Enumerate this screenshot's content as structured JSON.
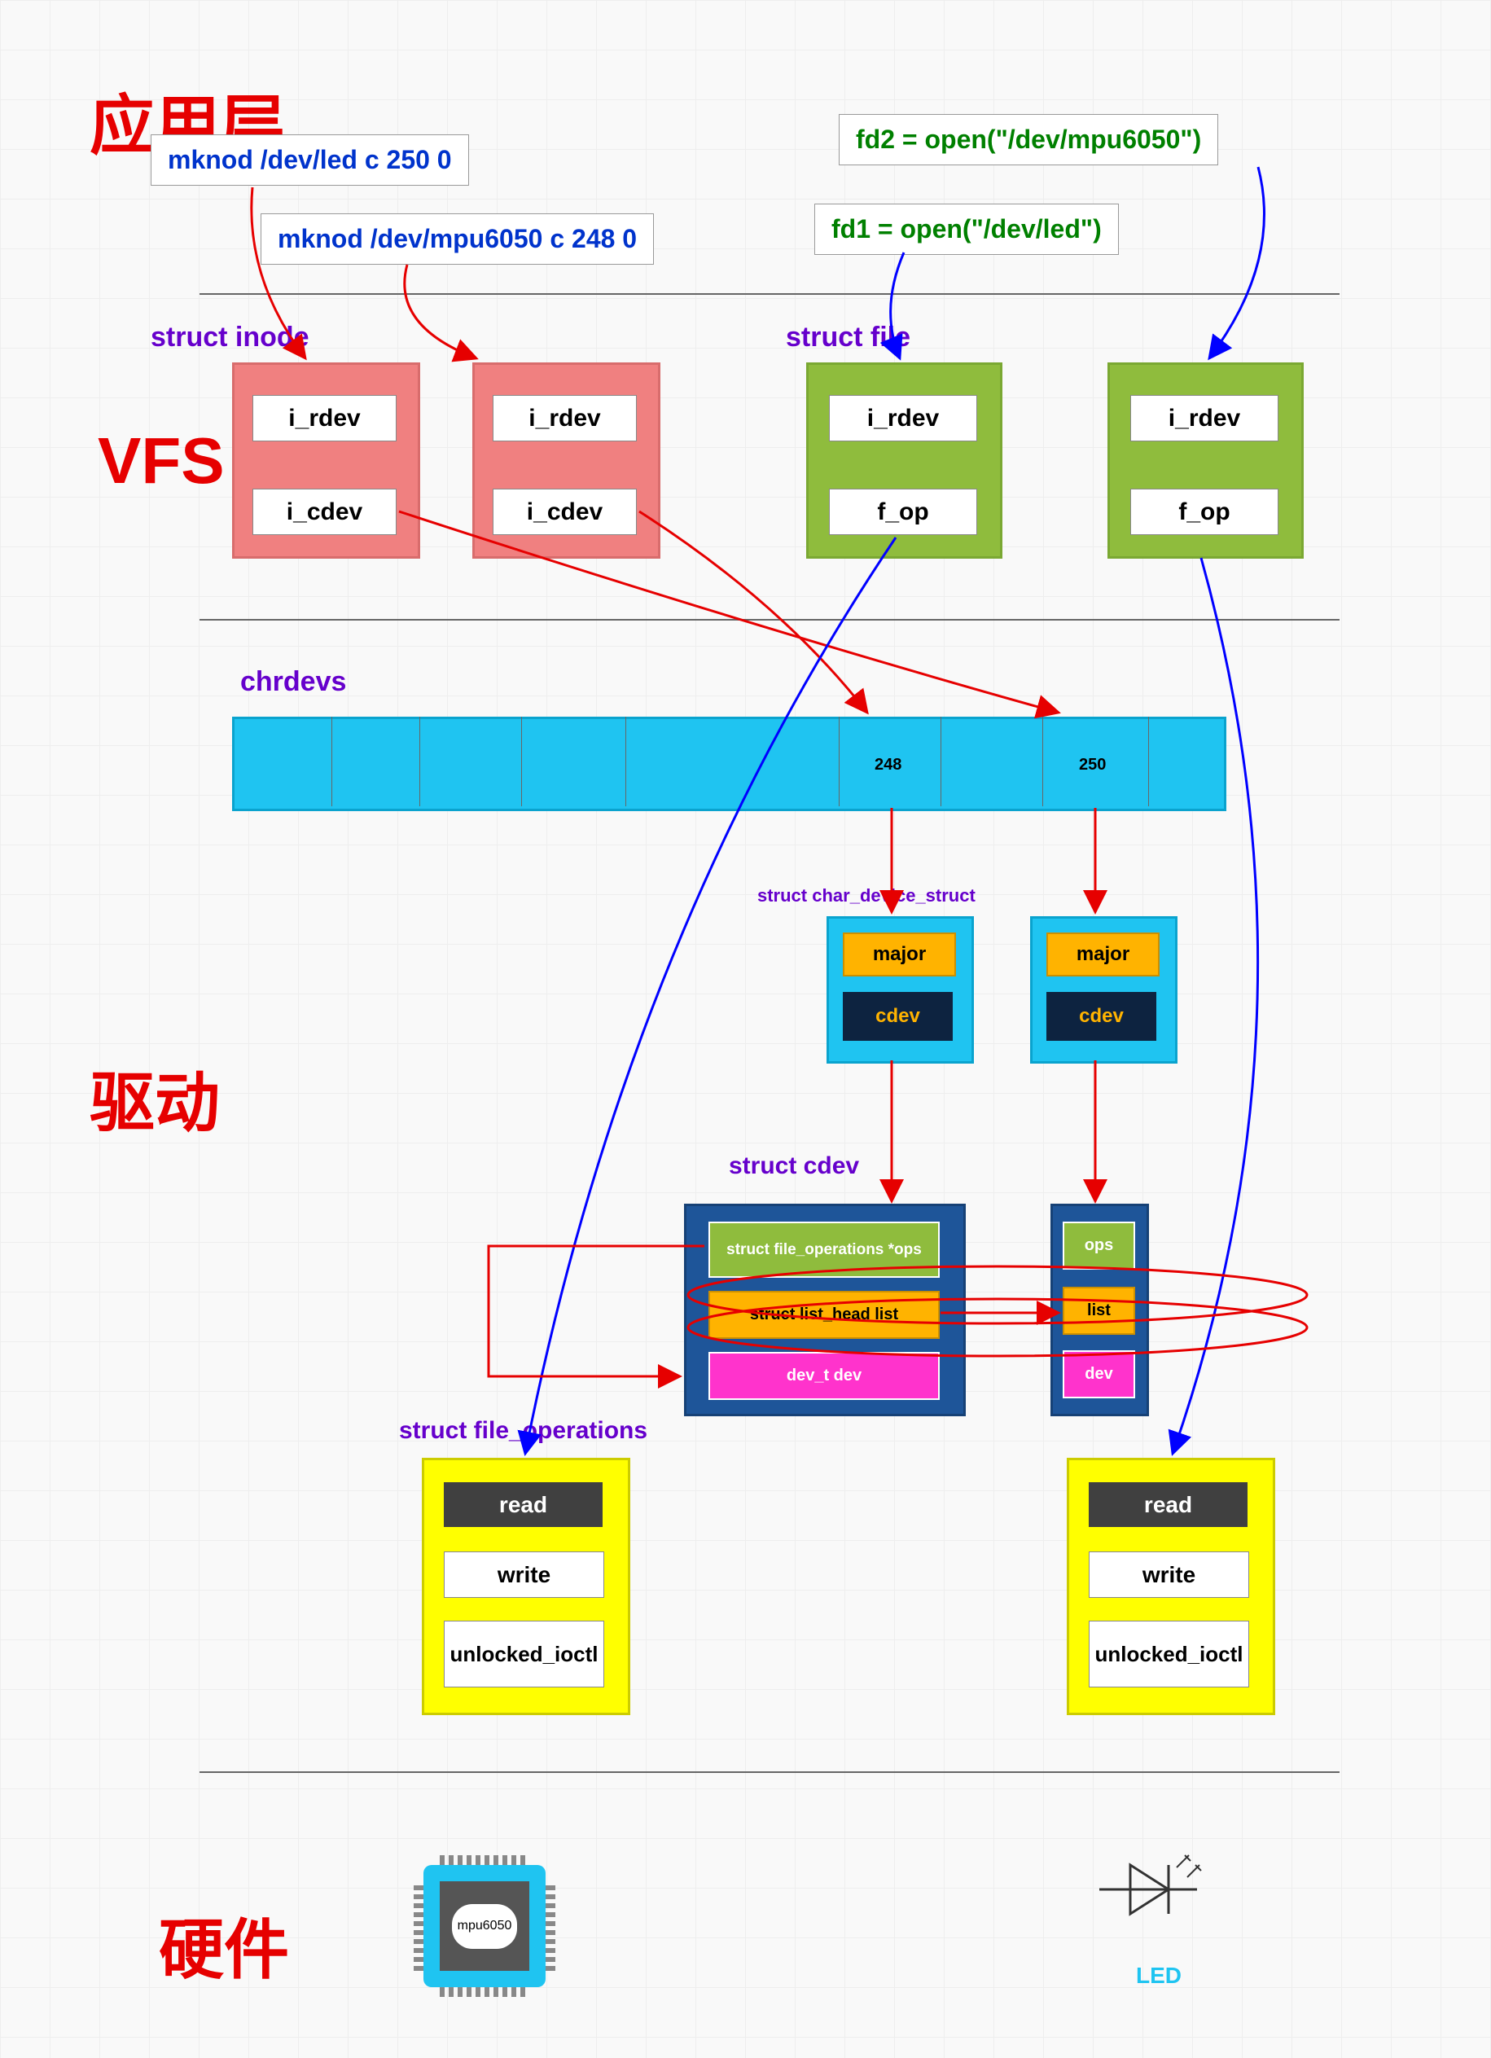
{
  "titles": {
    "app": "应用层",
    "vfs": "VFS",
    "driver": "驱动",
    "hw": "硬件"
  },
  "cmds": {
    "mknod1": "mknod /dev/led c 250 0",
    "mknod2": "mknod /dev/mpu6050 c 248 0",
    "open2": "fd2 = open(\"/dev/mpu6050\")",
    "open1": "fd1 = open(\"/dev/led\")"
  },
  "labels": {
    "inode": "struct inode",
    "file": "struct file",
    "chrdevs": "chrdevs",
    "cds": "struct char_device_struct",
    "cdev": "struct cdev",
    "fops": "struct file_operations",
    "led": "LED"
  },
  "fields": {
    "irdev": "i_rdev",
    "icdev": "i_cdev",
    "fop": "f_op",
    "major": "major",
    "cdev": "cdev",
    "ops": "ops",
    "list": "list",
    "dev": "dev",
    "sfops": "struct file_operations *ops",
    "slist": "struct list_head list",
    "sdev": "dev_t dev",
    "read": "read",
    "write": "write",
    "ioctl": "unlocked_ioctl"
  },
  "nums": {
    "n248": "248",
    "n250": "250"
  },
  "chip": "mpu6050"
}
